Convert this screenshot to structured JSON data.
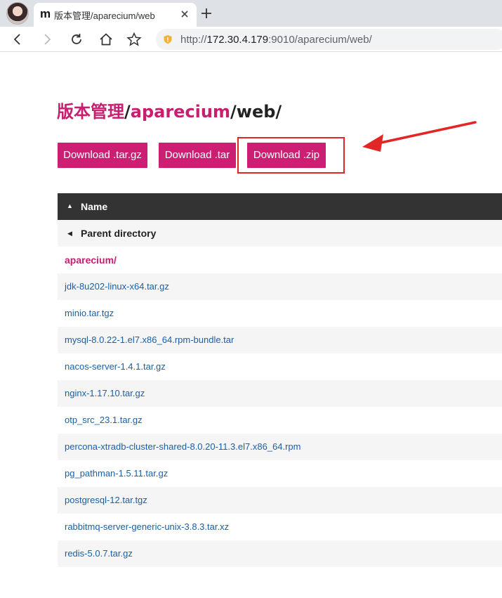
{
  "browser": {
    "tab_title": "版本管理/aparecium/web",
    "tab_favicon": "m",
    "url_scheme": "http://",
    "url_host": "172.30.4.179",
    "url_rest": ":9010/aparecium/web/"
  },
  "page": {
    "breadcrumb_root": "版本管理",
    "breadcrumb_sep1": "/",
    "breadcrumb_link": "aparecium",
    "breadcrumb_rest": "/web/"
  },
  "downloads": {
    "targz": "Download .tar.gz",
    "tar": "Download .tar",
    "zip": "Download .zip"
  },
  "listing": {
    "header": "Name",
    "parent": "Parent directory",
    "directory": "aparecium/",
    "files": [
      "jdk-8u202-linux-x64.tar.gz",
      "minio.tar.tgz",
      "mysql-8.0.22-1.el7.x86_64.rpm-bundle.tar",
      "nacos-server-1.4.1.tar.gz",
      "nginx-1.17.10.tar.gz",
      "otp_src_23.1.tar.gz",
      "percona-xtradb-cluster-shared-8.0.20-11.3.el7.x86_64.rpm",
      "pg_pathman-1.5.11.tar.gz",
      "postgresql-12.tar.tgz",
      "rabbitmq-server-generic-unix-3.8.3.tar.xz",
      "redis-5.0.7.tar.gz"
    ]
  },
  "colors": {
    "accent": "#cc1f73",
    "link": "#1a5fa8",
    "annotation": "#e22626",
    "table_header": "#333333"
  }
}
